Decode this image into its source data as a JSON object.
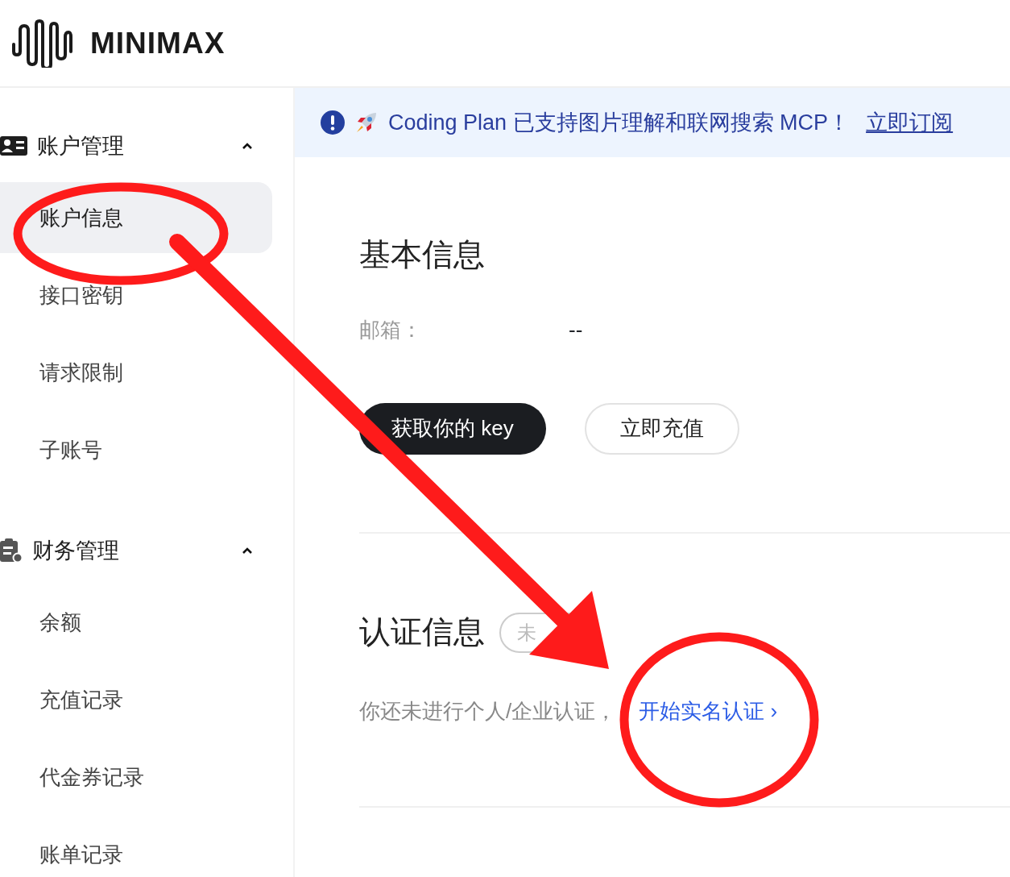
{
  "header": {
    "logo_text": "MINIMAX"
  },
  "sidebar": {
    "groups": [
      {
        "label": "账户管理",
        "expanded": true,
        "items": [
          {
            "label": "账户信息",
            "selected": true
          },
          {
            "label": "接口密钥",
            "selected": false
          },
          {
            "label": "请求限制",
            "selected": false
          },
          {
            "label": "子账号",
            "selected": false
          }
        ]
      },
      {
        "label": "财务管理",
        "expanded": true,
        "items": [
          {
            "label": "余额",
            "selected": false
          },
          {
            "label": "充值记录",
            "selected": false
          },
          {
            "label": "代金券记录",
            "selected": false
          },
          {
            "label": "账单记录",
            "selected": false
          }
        ]
      }
    ]
  },
  "banner": {
    "text": "Coding Plan 已支持图片理解和联网搜索 MCP！",
    "link": "立即订阅"
  },
  "basic_info": {
    "title": "基本信息",
    "fields": [
      {
        "label": "邮箱：",
        "value": "--"
      }
    ],
    "buttons": [
      {
        "label": "获取你的 key",
        "kind": "primary"
      },
      {
        "label": "立即充值",
        "kind": "outline"
      }
    ]
  },
  "verification": {
    "title": "认证信息",
    "badge": "未",
    "text": "你还未进行个人/企业认证，",
    "link": "开始实名认证",
    "link_chevron": "›"
  },
  "annotations": [
    {
      "kind": "circle"
    },
    {
      "kind": "arrow"
    },
    {
      "kind": "circle"
    }
  ]
}
